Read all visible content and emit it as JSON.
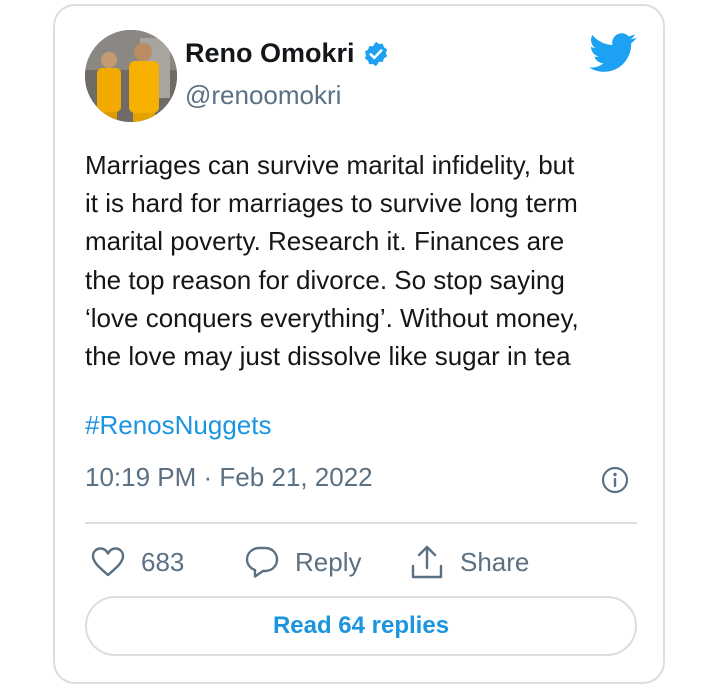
{
  "author": {
    "name": "Reno Omokri",
    "handle": "@renoomokri",
    "verified": true,
    "avatar_icon": "profile-photo-two-people-yellow-suits"
  },
  "platform_icon": "twitter-bird-icon",
  "tweet": {
    "text": "Marriages can survive marital infidelity, but\nit is hard for marriages to survive long term\nmarital poverty. Research it. Finances are\nthe top reason for divorce. So stop saying\n‘love conquers everything’. Without money,\nthe love may just dissolve like sugar in tea",
    "hashtag": "#RenosNuggets",
    "timestamp": "10:19 PM · Feb 21, 2022"
  },
  "actions": {
    "like_count": "683",
    "reply_label": "Reply",
    "share_label": "Share"
  },
  "read_replies_label": "Read 64 replies",
  "colors": {
    "accent": "#1b95e0",
    "text": "#14171a",
    "muted": "#5b7083",
    "border": "#d9dee2",
    "verified": "#1da1f2"
  }
}
